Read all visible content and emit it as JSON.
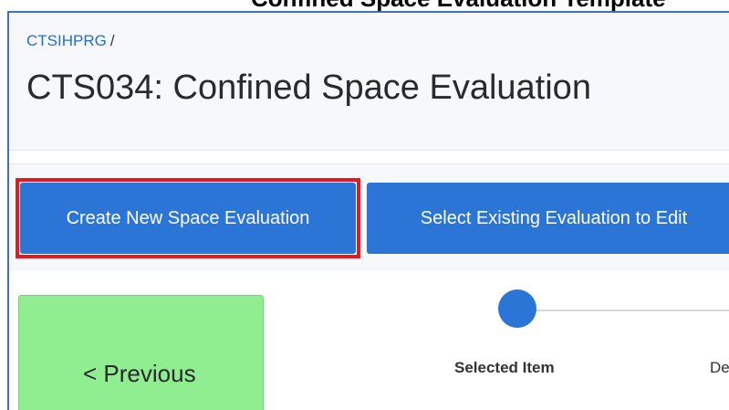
{
  "top_strip": {
    "clipped_text": "Confined Space Evaluation Template"
  },
  "header": {
    "breadcrumb": {
      "root": "CTSIHPRG",
      "separator": "/"
    },
    "title": "CTS034: Confined Space Evaluation"
  },
  "toolbar": {
    "create_label": "Create New Space Evaluation",
    "select_label": "Select Existing Evaluation to Edit"
  },
  "content": {
    "previous_label": "< Previous",
    "steps": [
      {
        "label": "Selected Item",
        "active": true
      },
      {
        "label": "De",
        "active": false
      }
    ]
  },
  "colors": {
    "accent": "#2b75d6",
    "highlight": "#e21a22",
    "previous_bg": "#90ee90",
    "panel_border": "#3f6fc3"
  },
  "icons": [
    "step-dot-icon"
  ]
}
